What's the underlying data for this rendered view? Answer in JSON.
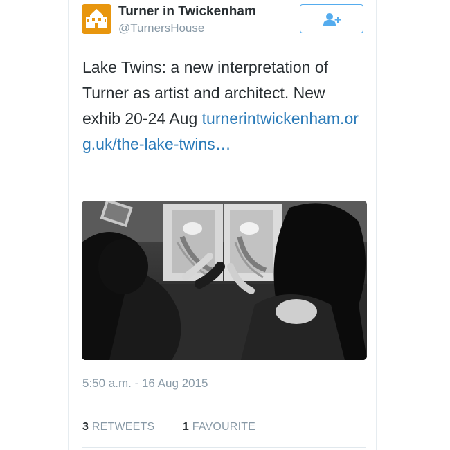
{
  "account": {
    "display_name": "Turner in Twickenham",
    "handle": "@TurnersHouse",
    "avatar_color": "#e8960e",
    "avatar_icon": "house-icon"
  },
  "follow_button": {
    "icon": "add-user-icon",
    "accent_color": "#55acee"
  },
  "tweet": {
    "text": "Lake Twins: a new interpretation of Turner as artist and architect. New exhib 20-24 Aug",
    "link": "turnerintwickenham.org.uk/the-lake-twins…",
    "link_color": "#2b7bb9",
    "timestamp": "5:50 a.m. - 16 Aug 2015"
  },
  "stats": {
    "retweets": {
      "count": "3",
      "label": "RETWEETS"
    },
    "favourites": {
      "count": "1",
      "label": "FAVOURITE"
    }
  }
}
